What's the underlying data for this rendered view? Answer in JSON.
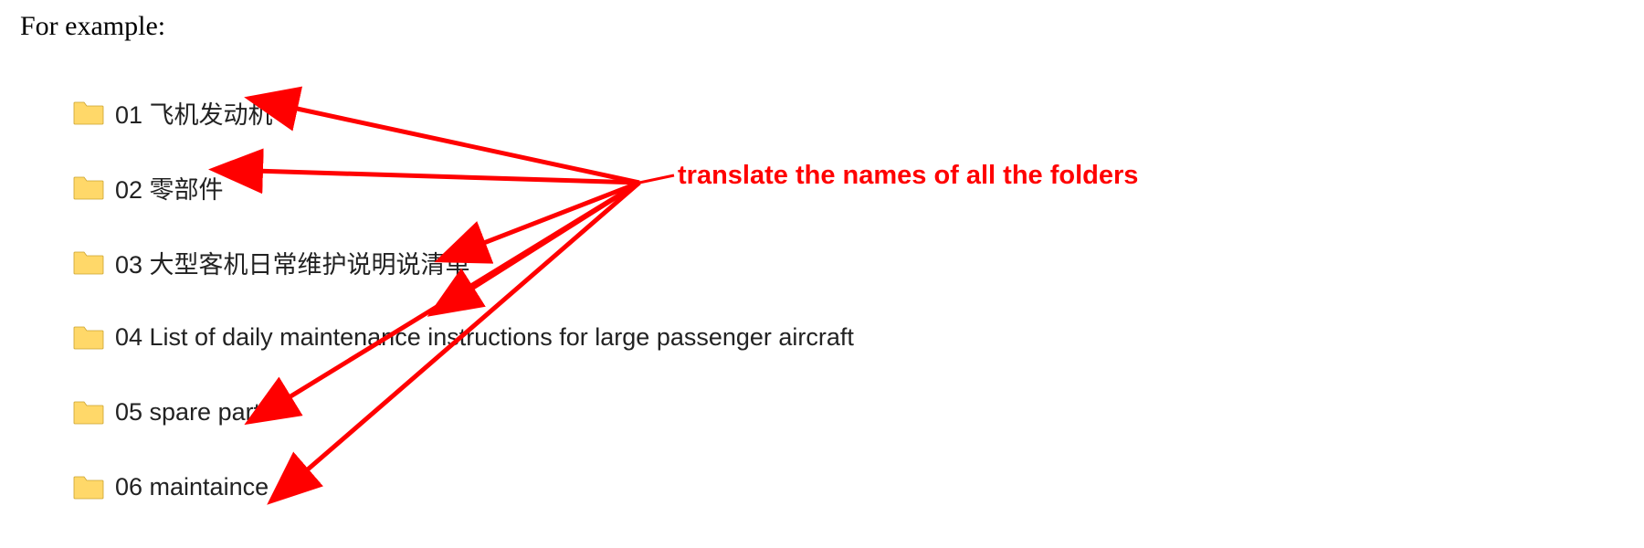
{
  "intro_text": "For example:",
  "annotation_text": "translate the names of all the folders",
  "folders": [
    {
      "label": "01 飞机发动机"
    },
    {
      "label": "02 零部件"
    },
    {
      "label": "03 大型客机日常维护说明说清单"
    },
    {
      "label": "04 List of daily maintenance instructions for large passenger aircraft"
    },
    {
      "label": "05 spare parts"
    },
    {
      "label": "06 maintaince"
    }
  ],
  "colors": {
    "arrow": "#ff0000",
    "folder_fill": "#ffd869",
    "folder_stroke": "#caa22f"
  }
}
